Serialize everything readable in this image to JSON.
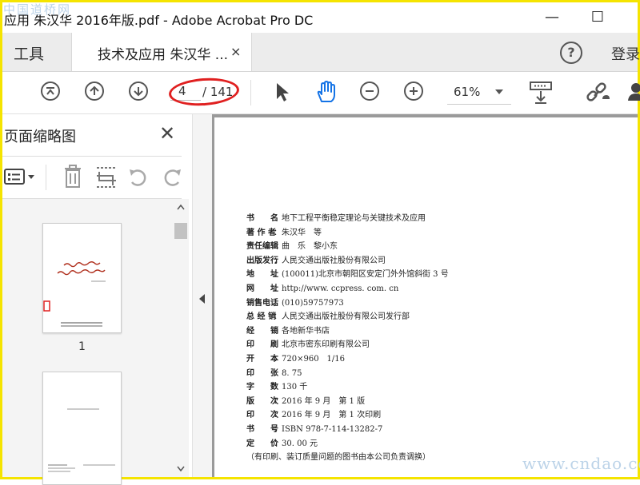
{
  "window": {
    "title": "应用 朱汉华 2016年版.pdf - Adobe Acrobat Pro DC",
    "minimize_glyph": "—",
    "maximize_glyph": "☐"
  },
  "watermarks": {
    "top": "中国道桥网",
    "bottom": "www.cndao.com"
  },
  "tabs": {
    "tools_label": "工具",
    "doc_label": "技术及应用 朱汉华 ...",
    "close_glyph": "×",
    "help_glyph": "?",
    "login_label": "登录"
  },
  "toolbar": {
    "current_page": "4",
    "total_pages": "/ 141",
    "zoom": "61%",
    "accent_color": "#1473e6",
    "icons": [
      "first-page-icon",
      "prev-page-icon",
      "next-page-icon",
      "select-arrow-icon",
      "hand-tool-icon",
      "zoom-out-icon",
      "zoom-in-icon",
      "zoom-caret-icon",
      "scroll-mode-icon",
      "share-link-icon",
      "user-icon"
    ]
  },
  "thumbnail_panel": {
    "title": "页面缩略图",
    "close_glyph": "✕",
    "icons": [
      "options-menu-icon",
      "trash-icon",
      "crop-icon",
      "rotate-left-icon",
      "rotate-right-icon"
    ],
    "thumbnails": [
      {
        "page_label": "1"
      },
      {
        "page_label": ""
      }
    ]
  },
  "document": {
    "rows": [
      {
        "label": "书　　名",
        "value": "地下工程平衡稳定理论与关键技术及应用"
      },
      {
        "label": "著 作 者",
        "value": "朱汉华　等"
      },
      {
        "label": "责任编辑",
        "value": "曲　乐　黎小东"
      },
      {
        "label": "出版发行",
        "value": "人民交通出版社股份有限公司"
      },
      {
        "label": "地　　址",
        "value": "(100011)北京市朝阳区安定门外外馆斜街 3 号"
      },
      {
        "label": "网　　址",
        "value": "http://www. ccpress. com. cn"
      },
      {
        "label": "销售电话",
        "value": "(010)59757973"
      },
      {
        "label": "总 经 销",
        "value": "人民交通出版社股份有限公司发行部"
      },
      {
        "label": "经　　销",
        "value": "各地新华书店"
      },
      {
        "label": "印　　刷",
        "value": "北京市密东印刷有限公司"
      },
      {
        "label": "开　　本",
        "value": "720×960　1/16"
      },
      {
        "label": "印　　张",
        "value": "8. 75"
      },
      {
        "label": "字　　数",
        "value": "130 千"
      },
      {
        "label": "版　　次",
        "value": "2016 年 9 月　第 1 版"
      },
      {
        "label": "印　　次",
        "value": "2016 年 9 月　第 1 次印刷"
      },
      {
        "label": "书　　号",
        "value": "ISBN 978-7-114-13282-7"
      },
      {
        "label": "定　　价",
        "value": "30. 00 元"
      }
    ],
    "note": "（有印刷、装订质量问题的图书由本公司负责调换）"
  }
}
